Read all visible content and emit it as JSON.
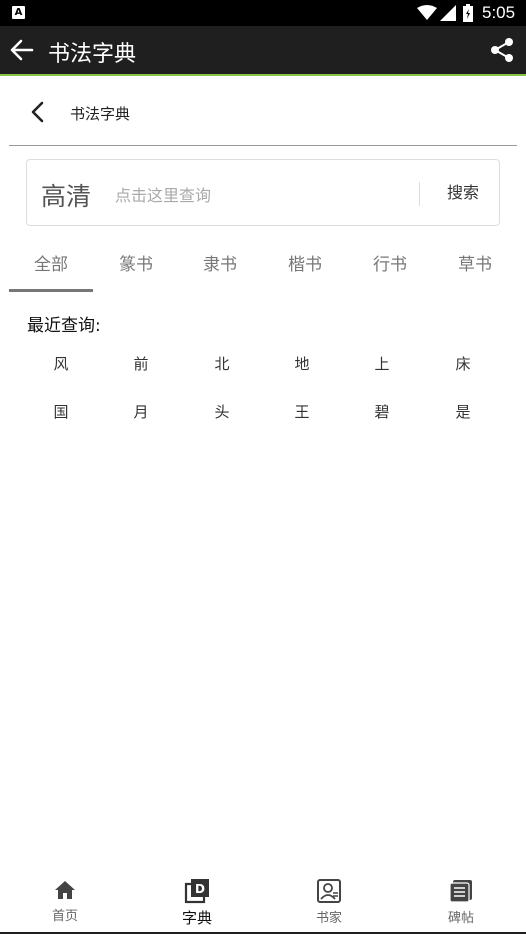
{
  "statusbar": {
    "time": "5:05",
    "icons": [
      "a-icon",
      "wifi-icon",
      "signal-icon",
      "battery-icon"
    ]
  },
  "appbar": {
    "title": "书法字典",
    "back_icon": "arrow-left-icon",
    "share_icon": "share-icon"
  },
  "subheader": {
    "title": "书法字典",
    "back_icon": "chevron-left-icon"
  },
  "search": {
    "quality_label": "高清",
    "placeholder": "点击这里查询",
    "button_label": "搜索"
  },
  "tabs": [
    {
      "label": "全部",
      "active": true
    },
    {
      "label": "篆书",
      "active": false
    },
    {
      "label": "隶书",
      "active": false
    },
    {
      "label": "楷书",
      "active": false
    },
    {
      "label": "行书",
      "active": false
    },
    {
      "label": "草书",
      "active": false
    }
  ],
  "recent": {
    "title": "最近查询:",
    "items": [
      "风",
      "前",
      "北",
      "地",
      "上",
      "床",
      "国",
      "月",
      "头",
      "王",
      "碧",
      "是"
    ]
  },
  "bottomnav": [
    {
      "label": "首页",
      "icon": "home-icon",
      "active": false
    },
    {
      "label": "字典",
      "icon": "dictionary-icon",
      "active": true
    },
    {
      "label": "书家",
      "icon": "person-card-icon",
      "active": false
    },
    {
      "label": "碑帖",
      "icon": "book-stack-icon",
      "active": false
    }
  ],
  "colors": {
    "appbar_bg": "#1f1f1f",
    "accent_line": "#8bc34a",
    "tab_text": "#777777"
  }
}
